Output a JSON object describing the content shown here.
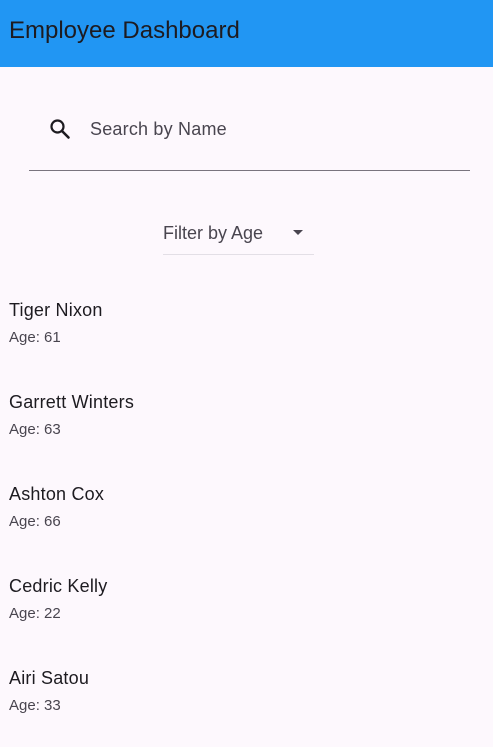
{
  "app_bar": {
    "title": "Employee Dashboard",
    "color": "#2196f3"
  },
  "search": {
    "icon": "search-icon",
    "placeholder": "Search by Name",
    "value": ""
  },
  "filter": {
    "label": "Filter by Age",
    "icon": "dropdown-arrow-icon"
  },
  "employees": [
    {
      "name": "Tiger Nixon",
      "age": "Age: 61"
    },
    {
      "name": "Garrett Winters",
      "age": "Age: 63"
    },
    {
      "name": "Ashton Cox",
      "age": "Age: 66"
    },
    {
      "name": "Cedric Kelly",
      "age": "Age: 22"
    },
    {
      "name": "Airi Satou",
      "age": "Age: 33"
    }
  ]
}
